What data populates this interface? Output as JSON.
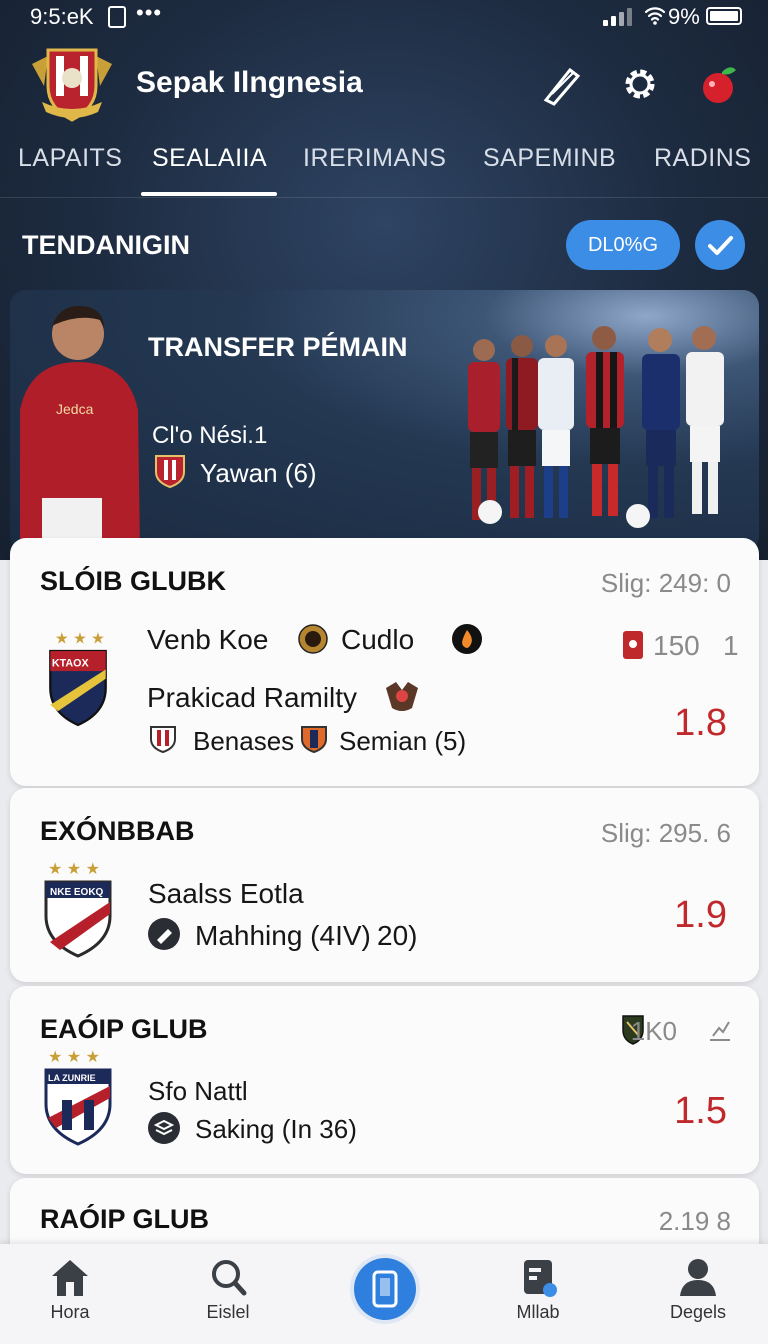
{
  "status_bar": {
    "time": "9:5:eK",
    "battery": "9%"
  },
  "app": {
    "title": "Sepak Ilngnesia"
  },
  "tabs": [
    {
      "label": "LAPAITS"
    },
    {
      "label": "SEALAIIA"
    },
    {
      "label": "IRERIMANS"
    },
    {
      "label": "SAPEMINB"
    },
    {
      "label": "RADINS"
    }
  ],
  "trending": {
    "title": "TENDANIGIN",
    "pill": "DL0%G"
  },
  "banner": {
    "title": "TRANSFER PÉMAIN",
    "subtitle": "Cl'o Nési.1",
    "count": "Yawan (6)",
    "jersey": "Jedca"
  },
  "cards": [
    {
      "title": "SLÓIB GLUBK",
      "meta": "Slig: 249: 0",
      "crest_text": "KTAOX",
      "line1_a": "Venb Koe",
      "line1_b": "Cudlo",
      "line2": "Prakicad Ramilty",
      "line3_a": "Benases",
      "line3_b": "Semian (5)",
      "right_stat": "150",
      "right_stat_b": "1",
      "odds": "1.8"
    },
    {
      "title": "EXÓNBBAB",
      "meta": "Slig: 295. 6",
      "crest_text": "NKE EOKQ",
      "line1": "Saalss Eotla",
      "line2_a": "Mahhing (4IV)",
      "line2_b": "20)",
      "odds": "1.9"
    },
    {
      "title": "EAÓIP GLUB",
      "meta": "1K0",
      "crest_text": "LA ZUNRIE",
      "line1": "Sfo Nattl",
      "line2": "Saking (In 36)",
      "odds": "1.5"
    },
    {
      "title": "RAÓIP GLUB",
      "meta": "2.19 8"
    }
  ],
  "bottom_nav": [
    {
      "label": "Hora",
      "icon": "home-icon"
    },
    {
      "label": "Eislel",
      "icon": "search-icon"
    },
    {
      "label": "",
      "icon": "phone-icon"
    },
    {
      "label": "Mllab",
      "icon": "clipboard-icon"
    },
    {
      "label": "Degels",
      "icon": "person-icon"
    }
  ],
  "colors": {
    "accent": "#3c8de6",
    "odds": "#c0292b",
    "header": "#1d2b40"
  }
}
